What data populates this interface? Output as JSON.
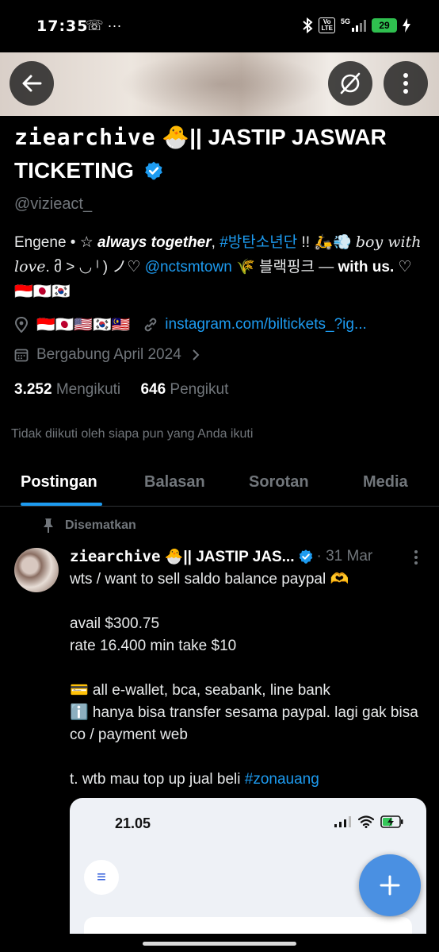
{
  "status_bar": {
    "time": "17:35",
    "left_icons": "☏ ···",
    "network": "5G",
    "volte": "Vo LTE",
    "battery": "29"
  },
  "profile": {
    "name_mono": "ziearchive",
    "name_rest": " 🐣|| JASTIP JASWAR TICKETING",
    "handle": "@vizieact_",
    "bio": {
      "part1": "Engene • ☆ ",
      "bold_italic": "always together",
      "part2": ", ",
      "hashtag": "#방탄소년단",
      "part3": " !! 🛵💨 ",
      "serif_italic": "boy with love",
      "part4": ". მ > ◡ ˡ ) ノ♡ ",
      "mention": "@nctsmtown",
      "part5": " 🌾 블랙핑크 — ",
      "bold_end": "with us.",
      "part6": " ♡ 🇮🇩🇯🇵🇰🇷"
    },
    "location_flags": "🇮🇩🇯🇵🇺🇸🇰🇷🇲🇾",
    "website": "instagram.com/biltickets_?ig...",
    "joined": "Bergabung April 2024",
    "following_count": "3.252",
    "following_label": "Mengikuti",
    "followers_count": "646",
    "followers_label": "Pengikut",
    "not_followed": "Tidak diikuti oleh siapa pun yang Anda ikuti"
  },
  "tabs": [
    "Postingan",
    "Balasan",
    "Sorotan",
    "Media"
  ],
  "pinned_label": "Disematkan",
  "post": {
    "author_mono": "ziearchive",
    "author_rest": " 🐣|| JASTIP JAS...",
    "date": "· 31 Mar",
    "line1": "wts / want to sell saldo balance paypal 🫶",
    "line2": "avail $300.75",
    "line3": "rate 16.400 min take $10",
    "line4": "💳 all e-wallet, bca, seabank, line bank",
    "line5": "ℹ️ hanya bisa transfer sesama paypal. lagi gak bisa co / payment web",
    "line6_pre": "t. wtb mau top up jual beli ",
    "hashtag": "#zonauang"
  },
  "media": {
    "time": "21.05"
  },
  "colors": {
    "accent": "#1d9bf0",
    "muted": "#71767b",
    "fab": "#4a90e2",
    "battery": "#2fbf4f"
  },
  "icons": [
    "back-arrow-icon",
    "grok-icon",
    "more-vertical-icon",
    "location-icon",
    "link-icon",
    "calendar-icon",
    "chevron-right-icon",
    "pin-icon",
    "verified-badge-icon",
    "plus-icon"
  ]
}
